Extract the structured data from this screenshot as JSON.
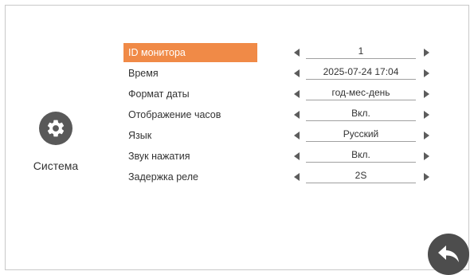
{
  "sidebar": {
    "label": "Система",
    "icon": "gear-icon"
  },
  "settings": [
    {
      "label": "ID монитора",
      "value": "1",
      "selected": true
    },
    {
      "label": "Время",
      "value": "2025-07-24 17:04",
      "selected": false
    },
    {
      "label": "Формат даты",
      "value": "год-мес-день",
      "selected": false
    },
    {
      "label": "Отображение часов",
      "value": "Вкл.",
      "selected": false
    },
    {
      "label": "Язык",
      "value": "Русский",
      "selected": false
    },
    {
      "label": "Звук нажатия",
      "value": "Вкл.",
      "selected": false
    },
    {
      "label": "Задержка реле",
      "value": "2S",
      "selected": false
    }
  ],
  "colors": {
    "accent": "#f08a47",
    "icon_bg": "#595959",
    "back_bg": "#4d4d4d"
  },
  "back_button": {
    "icon": "back-arrow-icon"
  }
}
